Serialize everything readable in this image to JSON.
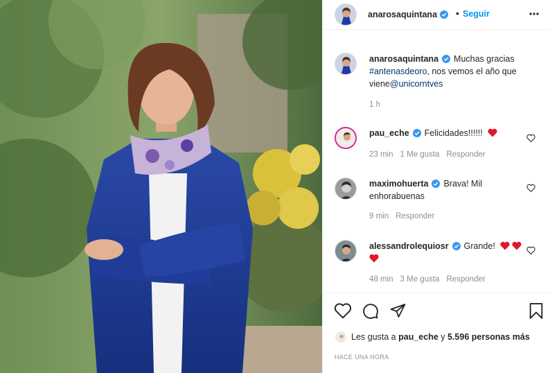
{
  "post": {
    "username": "anarosaquintana",
    "follow_label": "Seguir",
    "caption_username": "anarosaquintana",
    "caption_pre": "Muchas gracias ",
    "caption_hashtag": "#antenasdeoro",
    "caption_post": ", nos vemos el año que viene",
    "caption_mention": "@unicorntves",
    "caption_time": "1 h"
  },
  "comments": [
    {
      "username": "pau_eche",
      "text": "Felicidades!!!!!!",
      "time": "23 min",
      "likes": "1 Me gusta",
      "reply": "Responder"
    },
    {
      "username": "maximohuerta",
      "text": "Brava! Mil enhorabuenas",
      "time": "9 min",
      "reply": "Responder"
    },
    {
      "username": "alessandrolequiosr",
      "text": "Grande!",
      "time": "48 min",
      "likes": "3 Me gusta",
      "reply": "Responder"
    }
  ],
  "footer": {
    "likes_prefix": "Les gusta a ",
    "likes_user": "pau_eche",
    "likes_mid": " y ",
    "likes_count": "5.596 personas más",
    "posted": "HACE UNA HORA"
  },
  "colors": {
    "accent": "#0095f6",
    "heart": "#ed4956",
    "verified": "#3897f0",
    "muted": "#8e8e8e"
  }
}
